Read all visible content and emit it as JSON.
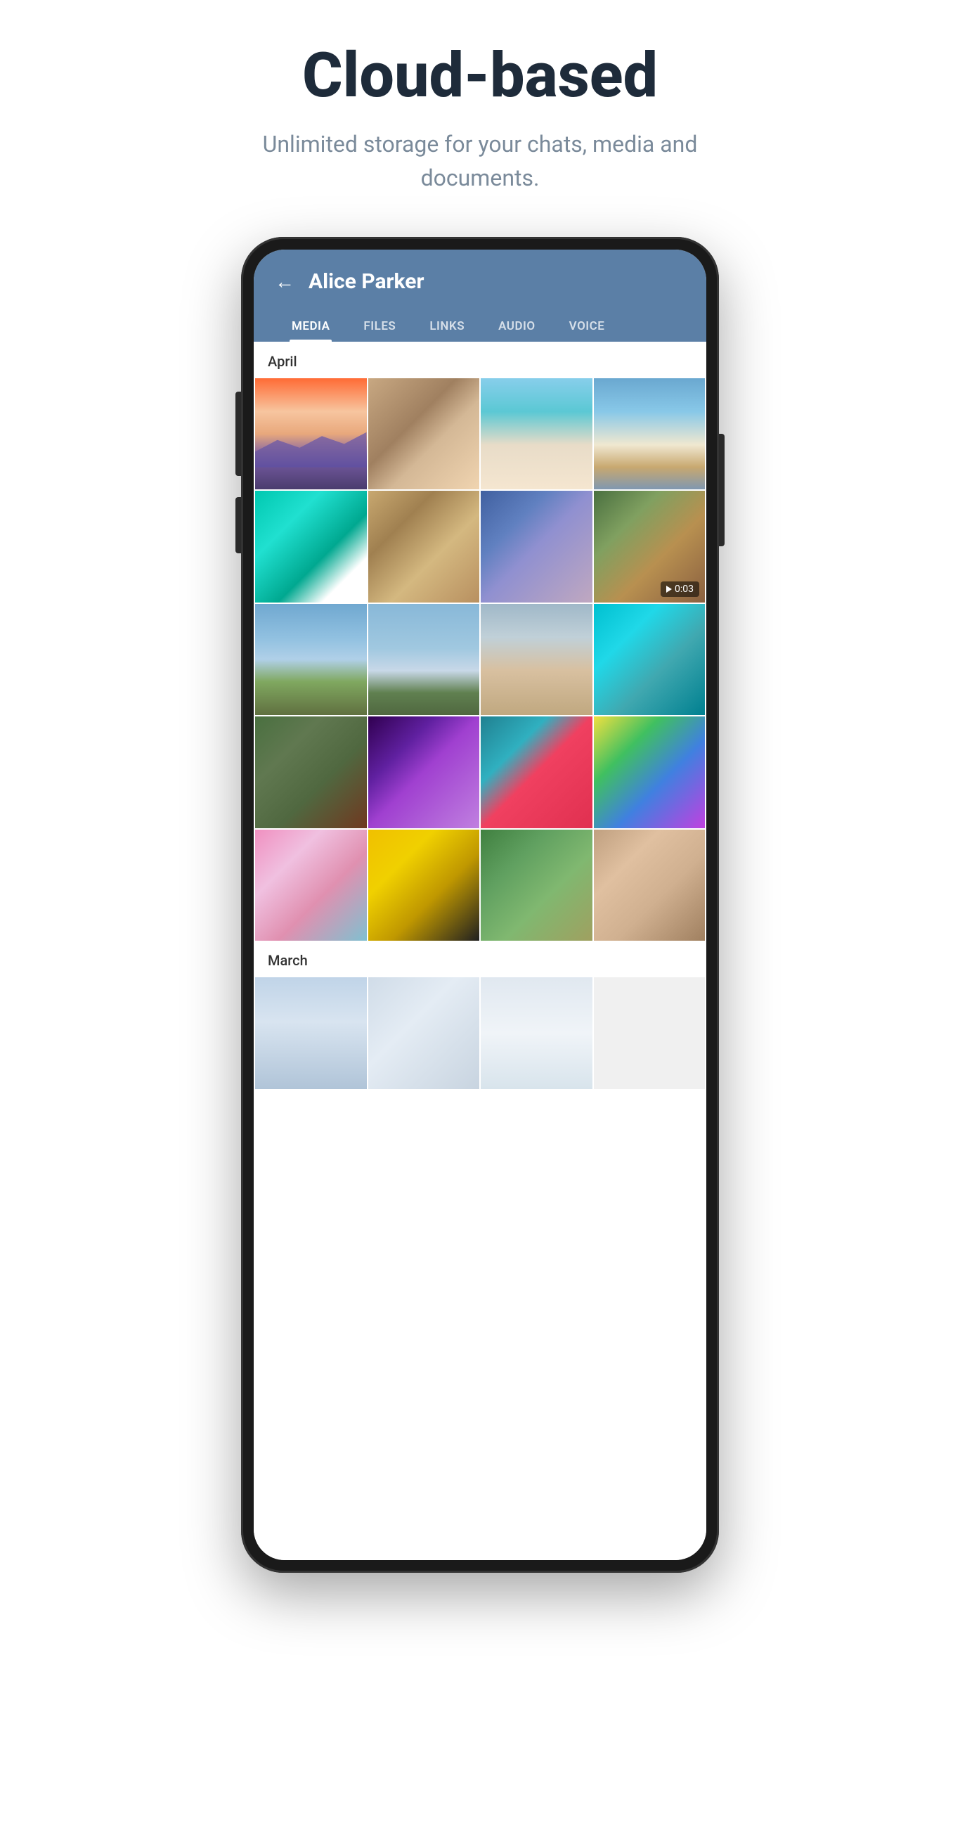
{
  "hero": {
    "title": "Cloud-based",
    "subtitle": "Unlimited storage for your chats, media and documents."
  },
  "app": {
    "header": {
      "back_label": "←",
      "contact_name": "Alice Parker"
    },
    "tabs": [
      {
        "id": "media",
        "label": "MEDIA",
        "active": true
      },
      {
        "id": "files",
        "label": "FILES",
        "active": false
      },
      {
        "id": "links",
        "label": "LINKS",
        "active": false
      },
      {
        "id": "audio",
        "label": "AUDIO",
        "active": false
      },
      {
        "id": "voice",
        "label": "VOICE",
        "active": false
      }
    ],
    "sections": [
      {
        "month": "April",
        "photos": [
          {
            "id": "sunset",
            "type": "image",
            "class": "photo-sunset"
          },
          {
            "id": "drinks",
            "type": "image",
            "class": "photo-drinks"
          },
          {
            "id": "beach",
            "type": "image",
            "class": "photo-beach"
          },
          {
            "id": "lifeguard",
            "type": "image",
            "class": "photo-lifeguard"
          },
          {
            "id": "wave",
            "type": "image",
            "class": "photo-wave"
          },
          {
            "id": "carving",
            "type": "image",
            "class": "photo-carving"
          },
          {
            "id": "concert",
            "type": "image",
            "class": "photo-concert"
          },
          {
            "id": "autumn",
            "type": "video",
            "class": "photo-autumn",
            "duration": "0:03"
          },
          {
            "id": "lake",
            "type": "image",
            "class": "photo-lake"
          },
          {
            "id": "calm-lake",
            "type": "image",
            "class": "photo-calm-lake"
          },
          {
            "id": "road",
            "type": "image",
            "class": "photo-road"
          },
          {
            "id": "turtle",
            "type": "image",
            "class": "photo-turtle"
          },
          {
            "id": "car-vintage",
            "type": "image",
            "class": "photo-car-vintage"
          },
          {
            "id": "festival",
            "type": "image",
            "class": "photo-festival"
          },
          {
            "id": "teal-car",
            "type": "image",
            "class": "photo-teal-car"
          },
          {
            "id": "holi",
            "type": "image",
            "class": "photo-holi"
          },
          {
            "id": "woman",
            "type": "image",
            "class": "photo-woman"
          },
          {
            "id": "yellow-car",
            "type": "image",
            "class": "photo-yellow-car"
          },
          {
            "id": "lion",
            "type": "image",
            "class": "photo-lion"
          },
          {
            "id": "cat",
            "type": "image",
            "class": "photo-cat"
          }
        ]
      },
      {
        "month": "March",
        "photos": [
          {
            "id": "march-1",
            "type": "image",
            "class": "photo-snow-tree"
          },
          {
            "id": "march-2",
            "type": "image",
            "class": "photo-winter-walk"
          }
        ]
      }
    ]
  }
}
